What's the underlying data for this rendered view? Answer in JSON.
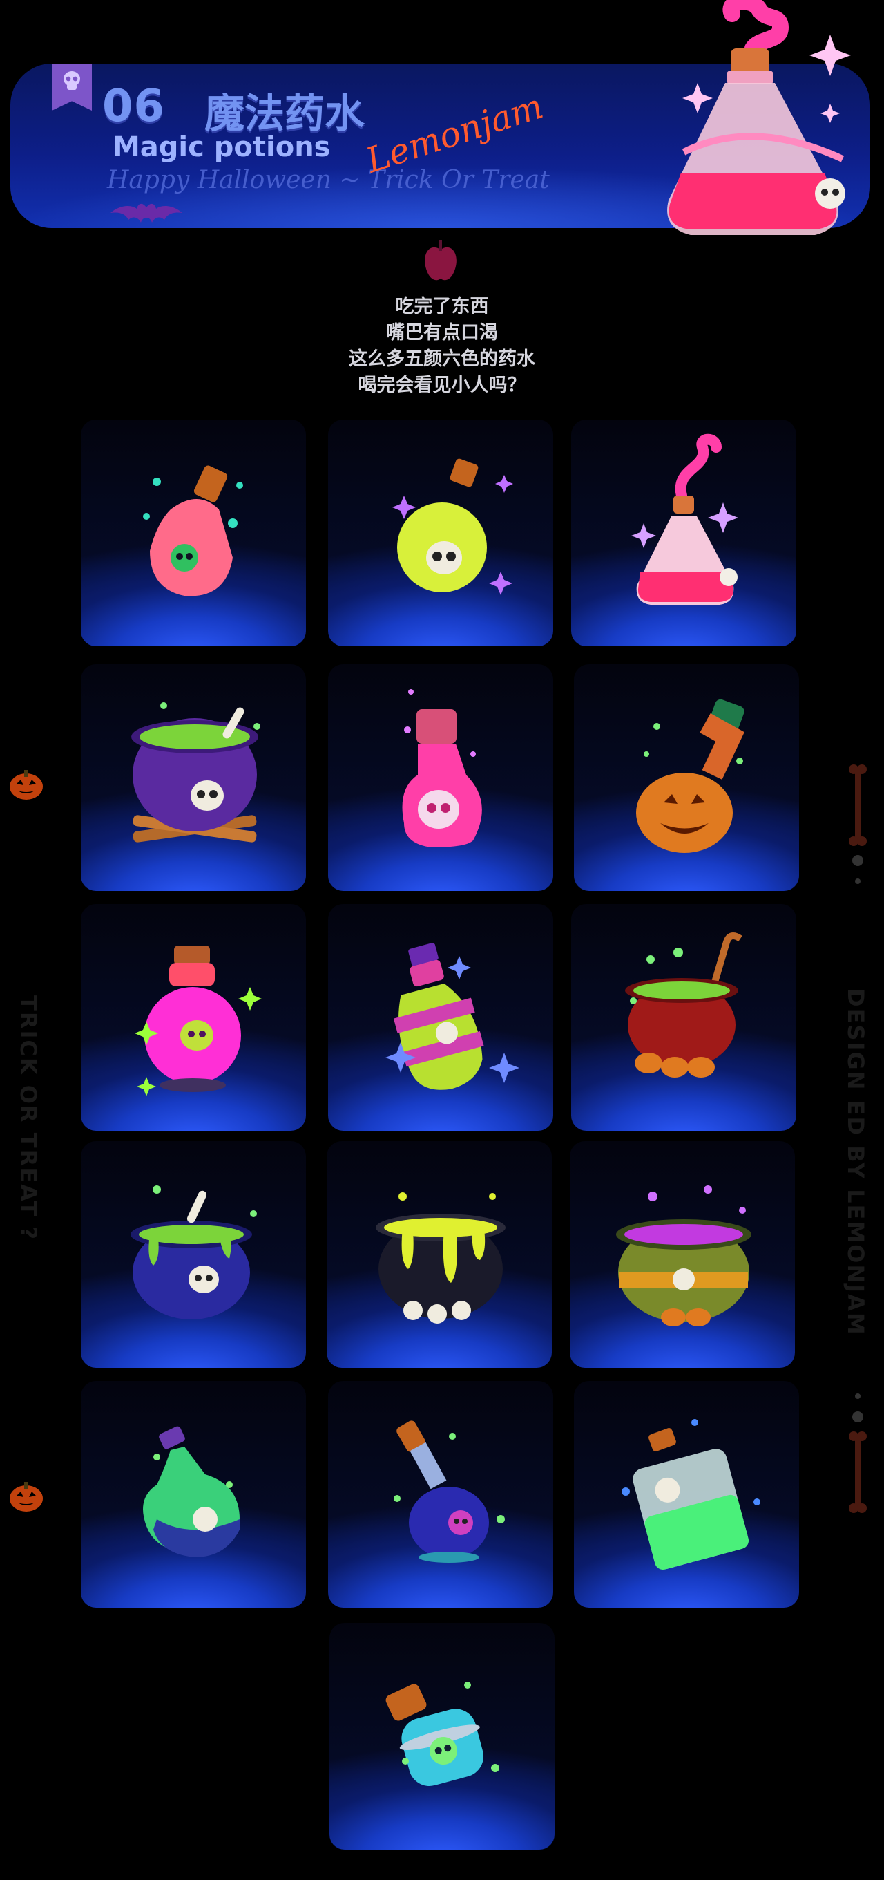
{
  "header": {
    "number": "06",
    "title_cn": "魔法药水",
    "title_en": "Magic potions",
    "subtitle": "Happy Halloween ~ Trick Or Treat",
    "signature": "Lemonjam"
  },
  "intro": {
    "lines": [
      "吃完了东西",
      "嘴巴有点口渴",
      "这么多五颜六色的药水",
      "喝完会看见小人吗？"
    ]
  },
  "side": {
    "left_text": "TRICK    OR    TREAT    ?",
    "right_text": "DESIGN ED BY LEMONJAM"
  },
  "icons": [
    "pink-heart-skull-bottle-icon",
    "yellow-skull-flask-icon",
    "pink-smoke-perfume-bottle-icon",
    "purple-cauldron-fire-icon",
    "pink-skull-bottle-icon",
    "pumpkin-flask-icon",
    "magenta-round-flask-icon",
    "striped-skull-bottle-icon",
    "red-cauldron-pumpkins-icon",
    "blue-cauldron-green-slime-icon",
    "black-cauldron-yellow-slime-icon",
    "olive-cauldron-purple-bubbles-icon",
    "green-jug-skull-icon",
    "blue-skull-flask-icon",
    "green-square-bottle-icon",
    "cyan-skull-flask-icon"
  ],
  "colors": {
    "banner": "#0d1e88",
    "title": "#7393f2",
    "signature": "#ff5a2e",
    "tile_glow": "#2f5cff"
  }
}
